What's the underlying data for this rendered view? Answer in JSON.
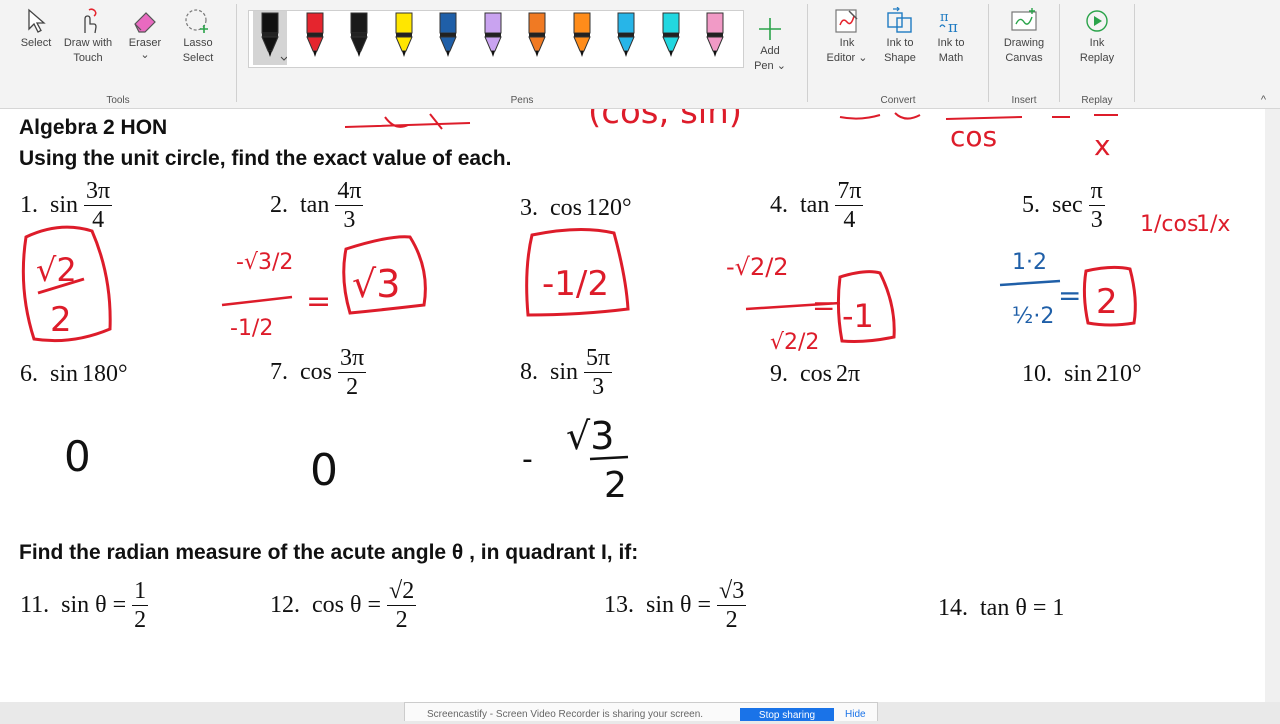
{
  "ribbon": {
    "tools": {
      "label": "Tools",
      "select": "Select",
      "draw_touch_1": "Draw with",
      "draw_touch_2": "Touch",
      "eraser": "Eraser",
      "eraser_caret": "⌄",
      "lasso_1": "Lasso",
      "lasso_2": "Select"
    },
    "pens": {
      "label": "Pens",
      "add_pen_1": "Add",
      "add_pen_2": "Pen ⌄",
      "colors": [
        "#111111",
        "#e5252e",
        "#1a1a1a",
        "#ffe600",
        "#1f5fa8",
        "#c9a3f0",
        "#f07a23",
        "#ff8c1a",
        "#27b5e8",
        "#22d7e0",
        "#f19ac6"
      ]
    },
    "convert": {
      "label": "Convert",
      "ink_editor_1": "Ink",
      "ink_editor_2": "Editor ⌄",
      "ink_shape_1": "Ink to",
      "ink_shape_2": "Shape",
      "ink_math_1": "Ink to",
      "ink_math_2": "Math"
    },
    "insert": {
      "label": "Insert",
      "drawing_1": "Drawing",
      "drawing_2": "Canvas"
    },
    "replay": {
      "label": "Replay",
      "ink_replay_1": "Ink",
      "ink_replay_2": "Replay"
    },
    "collapse": "^"
  },
  "doc": {
    "title": "Algebra 2  HON",
    "instructions": "Using the unit circle, find the exact value of each.",
    "problems": {
      "p1": {
        "num": "1.",
        "fn": "sin",
        "n": "3π",
        "d": "4"
      },
      "p2": {
        "num": "2.",
        "fn": "tan",
        "n": "4π",
        "d": "3"
      },
      "p3": {
        "num": "3.",
        "fn": "cos",
        "arg": "120°"
      },
      "p4": {
        "num": "4.",
        "fn": "tan",
        "n": "7π",
        "d": "4"
      },
      "p5": {
        "num": "5.",
        "fn": "sec",
        "n": "π",
        "d": "3"
      },
      "p6": {
        "num": "6.",
        "fn": "sin",
        "arg": "180°"
      },
      "p7": {
        "num": "7.",
        "fn": "cos",
        "n": "3π",
        "d": "2"
      },
      "p8": {
        "num": "8.",
        "fn": "sin",
        "n": "5π",
        "d": "3"
      },
      "p9": {
        "num": "9.",
        "fn": "cos",
        "arg": "2π"
      },
      "p10": {
        "num": "10.",
        "fn": "sin",
        "arg": "210°"
      }
    },
    "section2": "Find the radian measure of the acute angle θ , in quadrant I, if:",
    "problems2": {
      "p11": {
        "num": "11.",
        "lhs": "sin θ =",
        "n": "1",
        "d": "2"
      },
      "p12": {
        "num": "12.",
        "lhs": "cos θ =",
        "n": "√2",
        "d": "2"
      },
      "p13": {
        "num": "13.",
        "lhs": "sin θ =",
        "n": "√3",
        "d": "2"
      },
      "p14": {
        "num": "14.",
        "lhs": "tan θ = 1"
      }
    },
    "ink": {
      "top_cos_sin": "(cos, sin)",
      "top_cos": "cos",
      "top_x": "x",
      "a1_num": "√2",
      "a1_den": "2",
      "a2_top": "-√3/2",
      "a2_bot": "-1/2",
      "a2_eq": "=",
      "a2_ans": "√3",
      "a3_ans": "-1/2",
      "a4_top": "-√2/2",
      "a4_bot": "√2/2",
      "a4_eq": "=",
      "a4_ans": "-1",
      "a5_note1": "1/cos",
      "a5_note2": "1/x",
      "a5_work_top": "1·2",
      "a5_work_bot": "½·2",
      "a5_eq": "=",
      "a5_ans": "2",
      "a6_ans": "0",
      "a7_ans": "0",
      "a8_sign": "-",
      "a8_num": "√3",
      "a8_den": "2"
    }
  },
  "taskbar": {
    "notification": "Screencastify - Screen Video Recorder is sharing your screen.",
    "stop": "Stop sharing",
    "hide": "Hide"
  }
}
